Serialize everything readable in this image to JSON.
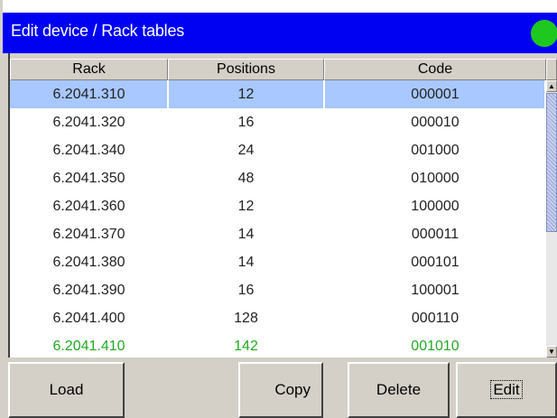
{
  "window": {
    "title": "Edit device / Rack tables",
    "status_color": "#1fc81f"
  },
  "table": {
    "columns": [
      "Rack",
      "Positions",
      "Code"
    ],
    "rows": [
      {
        "rack": "6.2041.310",
        "positions": "12",
        "code": "000001",
        "selected": true
      },
      {
        "rack": "6.2041.320",
        "positions": "16",
        "code": "000010"
      },
      {
        "rack": "6.2041.340",
        "positions": "24",
        "code": "001000"
      },
      {
        "rack": "6.2041.350",
        "positions": "48",
        "code": "010000"
      },
      {
        "rack": "6.2041.360",
        "positions": "12",
        "code": "100000"
      },
      {
        "rack": "6.2041.370",
        "positions": "14",
        "code": "000011"
      },
      {
        "rack": "6.2041.380",
        "positions": "14",
        "code": "000101"
      },
      {
        "rack": "6.2041.390",
        "positions": "16",
        "code": "100001"
      },
      {
        "rack": "6.2041.400",
        "positions": "128",
        "code": "000110"
      },
      {
        "rack": "6.2041.410",
        "positions": "142",
        "code": "001010",
        "highlight": "green"
      }
    ]
  },
  "scrollbar": {
    "up_icon": "arrow-up-icon",
    "down_icon": "arrow-down-icon"
  },
  "buttons": {
    "load": "Load",
    "copy": "Copy",
    "delete": "Delete",
    "edit": "Edit"
  }
}
